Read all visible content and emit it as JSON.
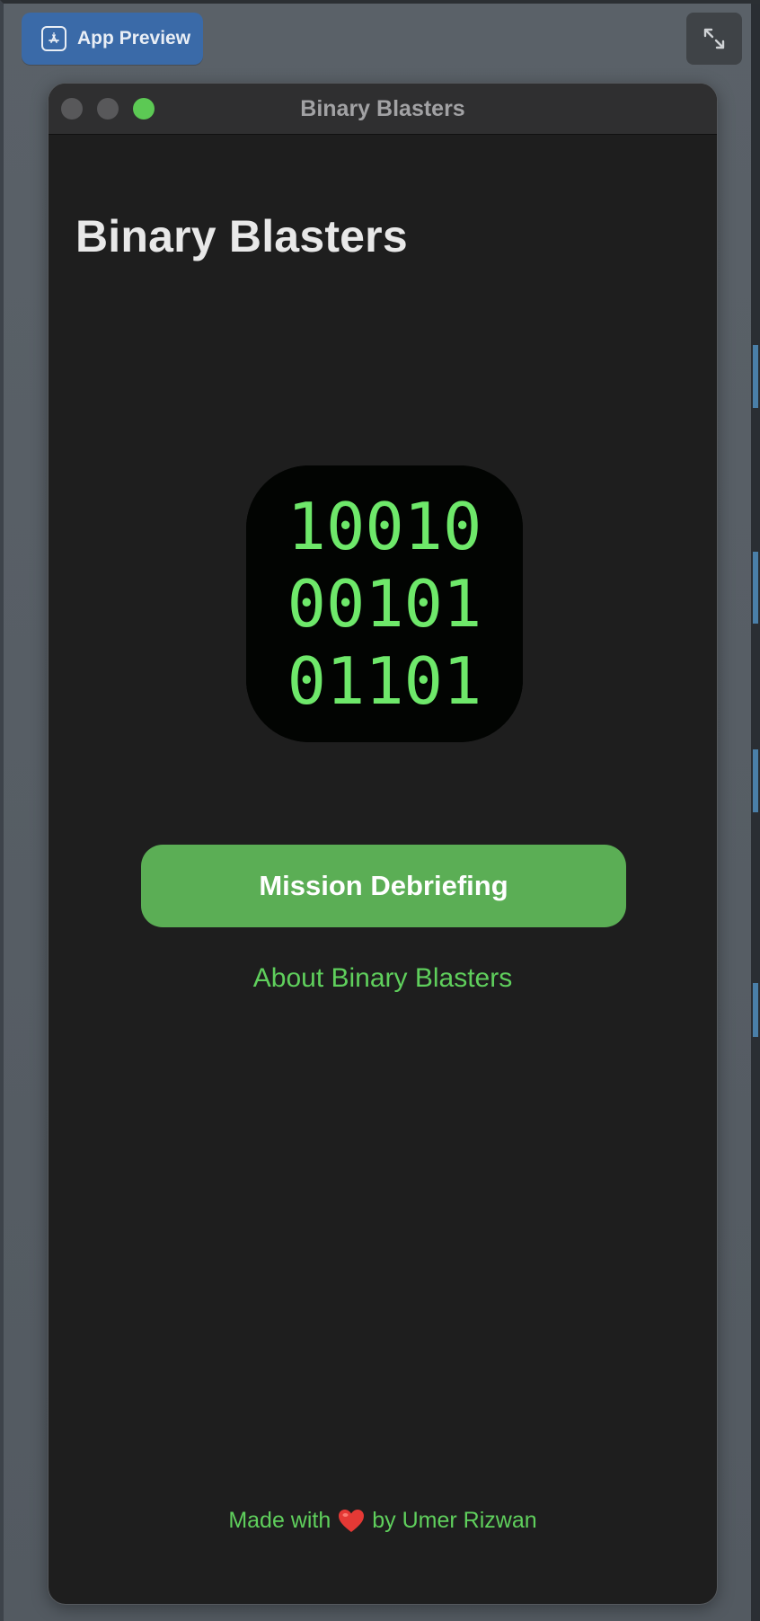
{
  "toolbar": {
    "preview_label": "App Preview",
    "preview_icon": "app-store-icon",
    "expand_icon": "expand-icon"
  },
  "window": {
    "title": "Binary Blasters"
  },
  "app": {
    "title": "Binary Blasters",
    "logo_lines": [
      "10010",
      "00101",
      "01101"
    ],
    "primary_button": "Mission Debriefing",
    "about_link": "About Binary Blasters",
    "footer_prefix": "Made with",
    "footer_icon": "heart-icon",
    "footer_suffix": "by Umer Rizwan"
  },
  "colors": {
    "accent_green": "#5fcf5c",
    "button_green": "#5bae55",
    "background": "#1e1e1e"
  }
}
